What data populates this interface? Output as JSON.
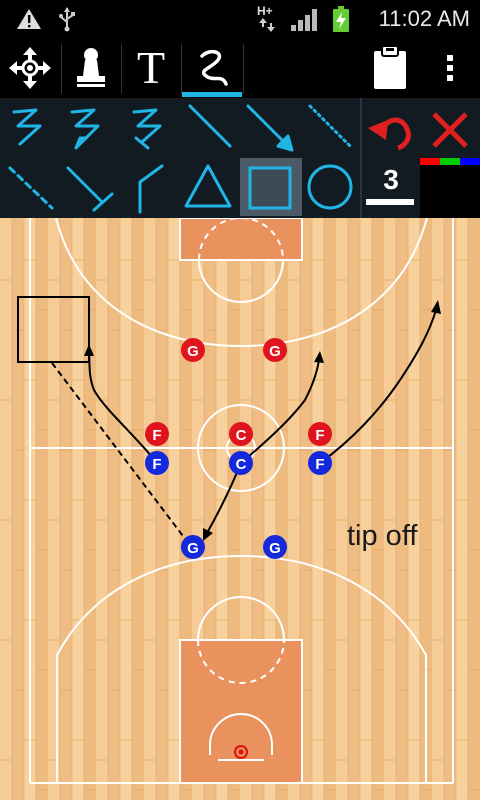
{
  "status_bar": {
    "time": "11:02 AM",
    "network": "H+",
    "icons": [
      "warning-icon",
      "usb-icon",
      "network-icon",
      "signal-icon",
      "battery-charging-icon"
    ]
  },
  "toolbar": {
    "tools": [
      "move-icon",
      "stamp-icon",
      "text-icon",
      "draw-icon",
      "clipboard-icon",
      "overflow-menu-icon"
    ],
    "text_tool_label": "T",
    "active_tool": "draw"
  },
  "palette": {
    "line_styles": [
      "squiggle",
      "squiggle-arrow",
      "squiggle-block",
      "straight",
      "straight-arrow",
      "dotted",
      "dashed",
      "straight-block",
      "angled",
      "triangle",
      "rectangle",
      "circle"
    ],
    "selected_style": "rectangle",
    "stroke_width": "3",
    "colors": [
      "#ff0000",
      "#00cc00",
      "#0000ff"
    ],
    "accent": "#1fb6e6",
    "undo_color": "#e02020",
    "delete_color": "#e02020"
  },
  "court": {
    "note": "tip off",
    "players": [
      {
        "label": "G",
        "team": "red"
      },
      {
        "label": "G",
        "team": "red"
      },
      {
        "label": "F",
        "team": "red"
      },
      {
        "label": "C",
        "team": "red"
      },
      {
        "label": "F",
        "team": "red"
      },
      {
        "label": "F",
        "team": "blue"
      },
      {
        "label": "C",
        "team": "blue"
      },
      {
        "label": "F",
        "team": "blue"
      },
      {
        "label": "G",
        "team": "blue"
      },
      {
        "label": "G",
        "team": "blue"
      }
    ],
    "team_colors": {
      "red": "#e0141e",
      "blue": "#1428dc"
    }
  }
}
